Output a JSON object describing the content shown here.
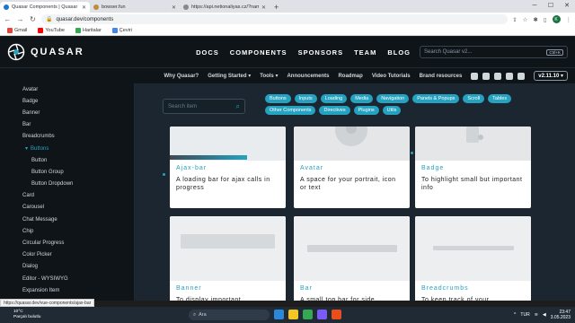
{
  "browser": {
    "tabs": [
      {
        "title": "Quasar Components | Quasar Fr",
        "active": true,
        "favicon_color": "#1976d2"
      },
      {
        "title": "bowser.fun",
        "active": false,
        "favicon_color": "#c28b3a"
      },
      {
        "title": "https://api.netionaliyas.cz/?name=",
        "active": false,
        "favicon_color": "#888888"
      }
    ],
    "url": "quasar.dev/components",
    "bookmarks": [
      {
        "label": "Gmail",
        "color": "#ea4335"
      },
      {
        "label": "YouTube",
        "color": "#ff0000"
      },
      {
        "label": "Haritalar",
        "color": "#34a853"
      },
      {
        "label": "Çeviri",
        "color": "#4285f4"
      }
    ],
    "profile_initial": "K"
  },
  "header": {
    "logo_text": "QUASAR",
    "nav": [
      "DOCS",
      "COMPONENTS",
      "SPONSORS",
      "TEAM",
      "BLOG"
    ],
    "search_placeholder": "Search Quasar v2...",
    "search_shortcut": "Ctrl+K"
  },
  "subnav": {
    "links": [
      "Why Quasar?",
      "Getting Started ▾",
      "Tools ▾",
      "Announcements",
      "Roadmap",
      "Video Tutorials",
      "Brand resources"
    ],
    "version": "v2.11.10 ▾"
  },
  "sidebar": {
    "items": [
      {
        "label": "Avatar",
        "level": 0
      },
      {
        "label": "Badge",
        "level": 0
      },
      {
        "label": "Banner",
        "level": 0
      },
      {
        "label": "Bar",
        "level": 0
      },
      {
        "label": "Breadcrumbs",
        "level": 0
      },
      {
        "label": "Buttons",
        "level": 1,
        "active": true
      },
      {
        "label": "Button",
        "level": 2
      },
      {
        "label": "Button Group",
        "level": 2
      },
      {
        "label": "Button Dropdown",
        "level": 2
      },
      {
        "label": "Card",
        "level": 0
      },
      {
        "label": "Carousel",
        "level": 0
      },
      {
        "label": "Chat Message",
        "level": 0
      },
      {
        "label": "Chip",
        "level": 0
      },
      {
        "label": "Circular Progress",
        "level": 0
      },
      {
        "label": "Color Picker",
        "level": 0
      },
      {
        "label": "Dialog",
        "level": 0
      },
      {
        "label": "Editor - WYSIWYG",
        "level": 0
      },
      {
        "label": "Expansion Item",
        "level": 0
      }
    ]
  },
  "main": {
    "filter_placeholder": "Search item",
    "chips": [
      "Buttons",
      "Inputs",
      "Loading",
      "Media",
      "Navigation",
      "Panels & Popups",
      "Scroll",
      "Tables",
      "Other Components",
      "Directives",
      "Plugins",
      "Utils"
    ],
    "cards": [
      {
        "name": "Ajax-bar",
        "desc": "A loading bar for ajax calls in progress"
      },
      {
        "name": "Avatar",
        "desc": "A space for your portrait, icon or text"
      },
      {
        "name": "Badge",
        "desc": "To highlight small but important info"
      },
      {
        "name": "Banner",
        "desc": "To display important"
      },
      {
        "name": "Bar",
        "desc": "A small top bar for side"
      },
      {
        "name": "Breadcrumbs",
        "desc": "To keep track of your"
      }
    ]
  },
  "status_url": "https://quasar.dev/vue-components/ajax-bar",
  "taskbar": {
    "weather_temp": "10°C",
    "weather_desc": "Parçalı bulutlu",
    "search_label": "Ara",
    "lang": "TUR",
    "time": "23:47",
    "date": "3.05.2023"
  }
}
